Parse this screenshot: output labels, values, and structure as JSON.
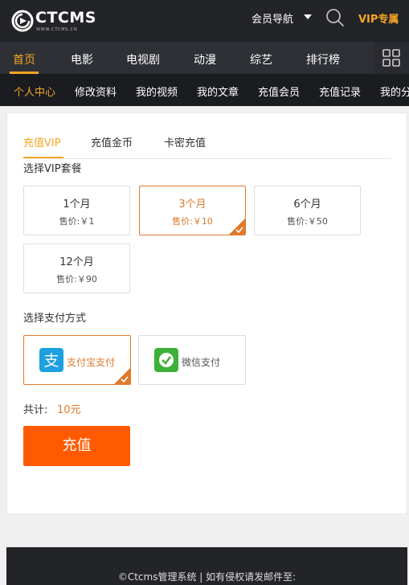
{
  "header": {
    "logo_text": "CTCMS",
    "logo_sub": "WWW.CTCMS.CN",
    "member_nav_label": "会员导航",
    "vip_label": "VIP专属"
  },
  "main_nav": {
    "items": [
      {
        "label": "首页",
        "active": true
      },
      {
        "label": "电影"
      },
      {
        "label": "电视剧"
      },
      {
        "label": "动漫"
      },
      {
        "label": "综艺"
      },
      {
        "label": "排行榜"
      }
    ]
  },
  "sub_nav": {
    "items": [
      {
        "label": "个人中心",
        "active": true
      },
      {
        "label": "修改资料"
      },
      {
        "label": "我的视频"
      },
      {
        "label": "我的文章"
      },
      {
        "label": "充值会员"
      },
      {
        "label": "充值记录"
      },
      {
        "label": "我的分"
      }
    ]
  },
  "tabs": [
    {
      "label": "充值VIP",
      "active": true
    },
    {
      "label": "充值金币"
    },
    {
      "label": "卡密充值"
    }
  ],
  "plan_section_title": "选择VIP套餐",
  "plans": [
    {
      "name": "1个月",
      "price": "售价:￥1"
    },
    {
      "name": "3个月",
      "price": "售价:￥10",
      "selected": true
    },
    {
      "name": "6个月",
      "price": "售价:￥50"
    },
    {
      "name": "12个月",
      "price": "售价:￥90"
    }
  ],
  "payment_section_title": "选择支付方式",
  "payments": [
    {
      "label": "支付宝支付",
      "icon": "alipay-icon",
      "selected": true
    },
    {
      "label": "微信支付",
      "icon": "wechat-pay-icon"
    }
  ],
  "total": {
    "label": "共计:",
    "value": "10元"
  },
  "recharge_button": "充值",
  "footer": {
    "text": "©Ctcms管理系统 | 如有侵权请发邮件至:"
  },
  "colors": {
    "accent": "#f5a623",
    "selected_border": "#e0792c",
    "button": "#ff5a00",
    "header_bg": "#232428"
  }
}
